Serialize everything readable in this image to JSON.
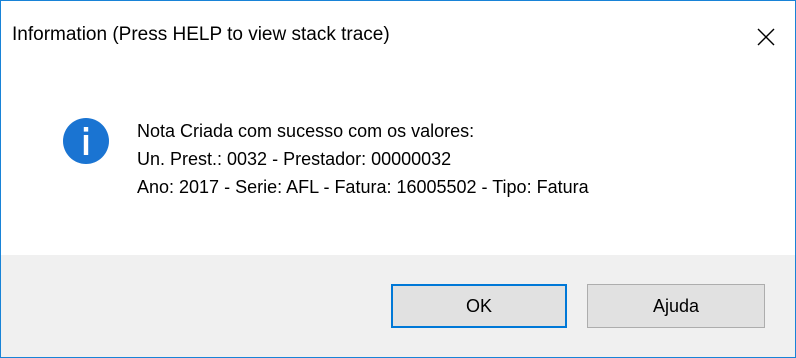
{
  "window": {
    "title": "Information (Press HELP to view stack trace)"
  },
  "icons": {
    "close": "close-icon",
    "info": "info-icon"
  },
  "colors": {
    "info_icon_blue": "#1a74d2",
    "window_border": "#1883d7",
    "default_button_border": "#0078d7",
    "footer_bg": "#f0f0f0"
  },
  "message": {
    "lines": [
      "Nota Criada com sucesso com os valores:",
      "Un. Prest.: 0032 - Prestador: 00000032",
      "Ano: 2017 - Serie: AFL - Fatura: 16005502 - Tipo: Fatura"
    ]
  },
  "buttons": {
    "ok_label": "OK",
    "help_label": "Ajuda"
  }
}
